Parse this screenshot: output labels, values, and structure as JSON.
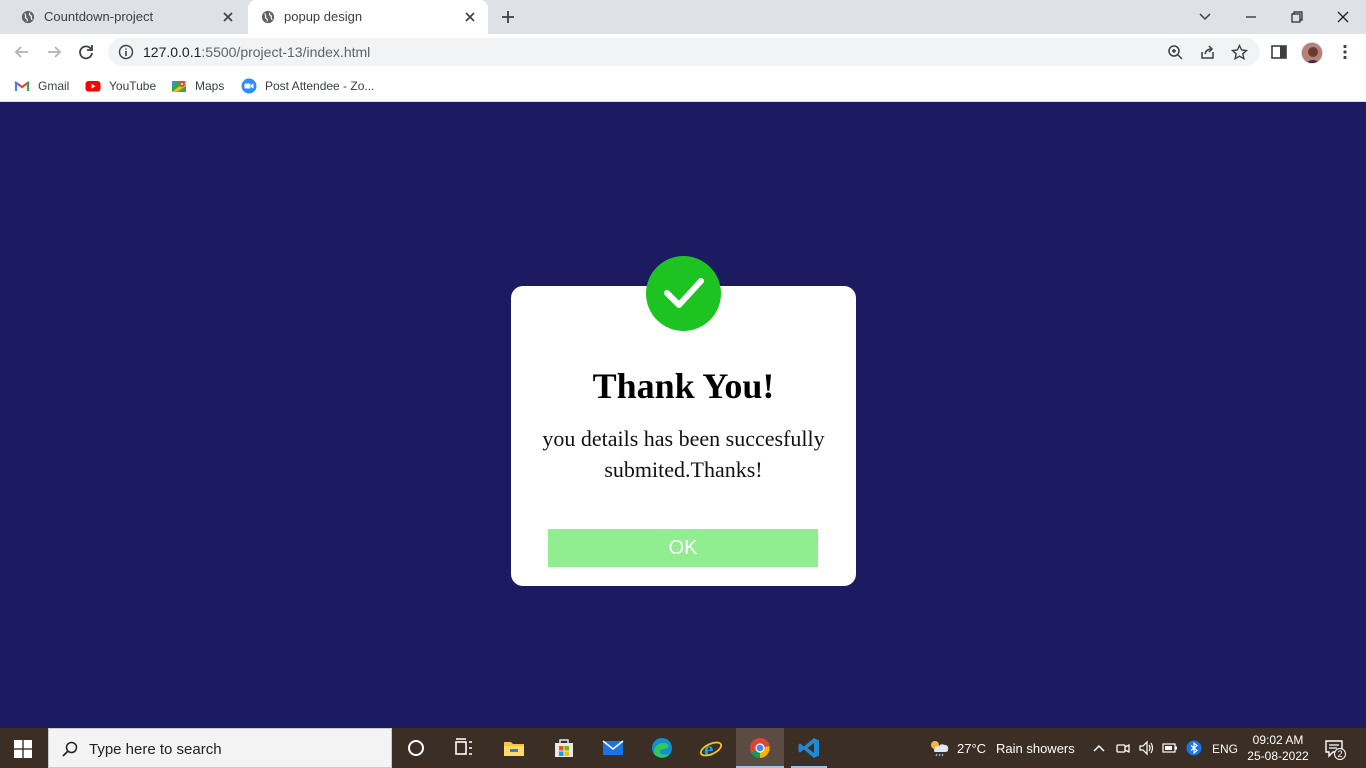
{
  "browser": {
    "tabs": [
      {
        "title": "Countdown-project",
        "active": false
      },
      {
        "title": "popup design",
        "active": true
      }
    ],
    "url_host": "127.0.0.1",
    "url_path": ":5500/project-13/index.html",
    "bookmarks": [
      {
        "label": "Gmail",
        "icon": "gmail-icon"
      },
      {
        "label": "YouTube",
        "icon": "youtube-icon"
      },
      {
        "label": "Maps",
        "icon": "maps-icon"
      },
      {
        "label": "Post Attendee - Zo...",
        "icon": "zoom-icon"
      }
    ]
  },
  "popup": {
    "icon": "check-icon",
    "title": "Thank You!",
    "message": "you details has been succesfully submited.Thanks!",
    "ok_label": "OK",
    "colors": {
      "page_bg": "#1c1b62",
      "check_bg": "#1cc321",
      "ok_bg": "#90ee90"
    }
  },
  "taskbar": {
    "search_placeholder": "Type here to search",
    "weather_temp": "27°C",
    "weather_desc": "Rain showers",
    "language": "ENG",
    "time": "09:02 AM",
    "date": "25-08-2022",
    "notification_count": "2"
  }
}
